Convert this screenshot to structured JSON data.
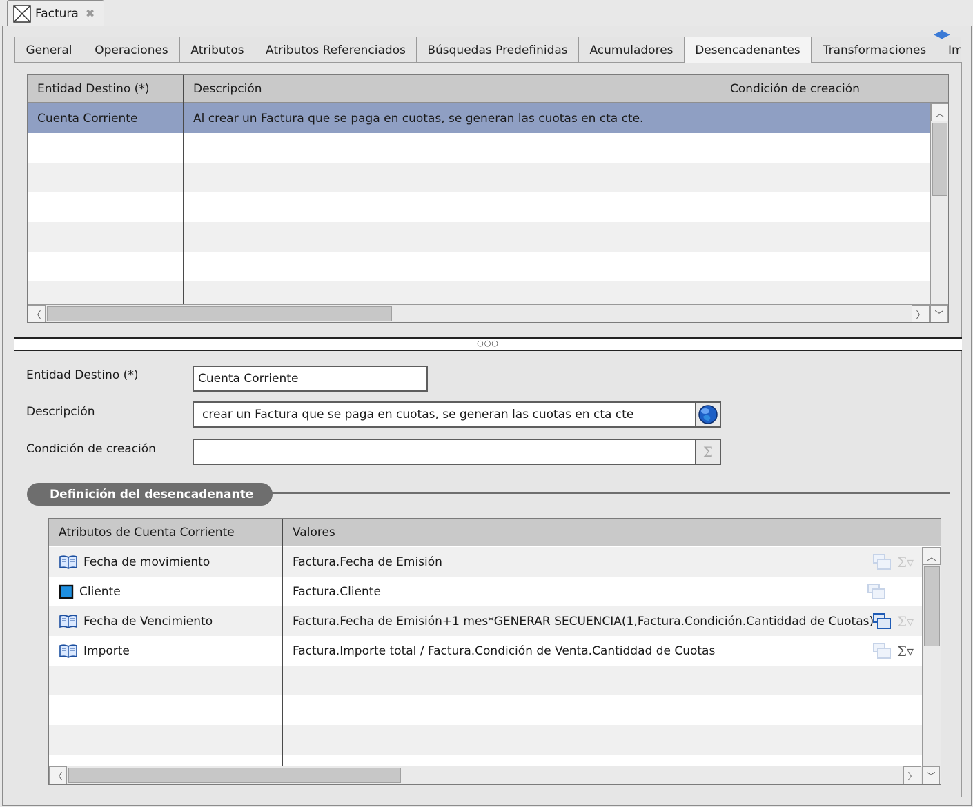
{
  "editor": {
    "title": "Factura"
  },
  "tabs": [
    {
      "label": "General"
    },
    {
      "label": "Operaciones"
    },
    {
      "label": "Atributos"
    },
    {
      "label": "Atributos Referenciados"
    },
    {
      "label": "Búsquedas Predefinidas"
    },
    {
      "label": "Acumuladores"
    },
    {
      "label": "Desencadenantes"
    },
    {
      "label": "Transformaciones"
    },
    {
      "label": "Im"
    }
  ],
  "active_tab": "Desencadenantes",
  "triggers_table": {
    "columns": [
      "Entidad Destino (*)",
      "Descripción",
      "Condición de creación"
    ],
    "rows": [
      {
        "entidad": "Cuenta Corriente",
        "descripcion": "Al crear un Factura que se paga en cuotas, se generan las cuotas en cta cte.",
        "condicion": ""
      }
    ]
  },
  "form": {
    "entidad_label": "Entidad Destino (*)",
    "entidad_value": "Cuenta Corriente",
    "descripcion_label": "Descripción",
    "descripcion_value": "crear un Factura que se paga en cuotas, se generan las cuotas en cta cte",
    "condicion_label": "Condición de creación",
    "condicion_value": ""
  },
  "section": {
    "title": "Definición del desencadenante"
  },
  "definition_table": {
    "columns": [
      "Atributos de Cuenta Corriente",
      "Valores"
    ],
    "rows": [
      {
        "icon": "book-icon",
        "attr": "Fecha de movimiento",
        "valor": "Factura.Fecha de Emisión",
        "sigma": true,
        "sigma_active": false,
        "copy_active": false
      },
      {
        "icon": "entity-square-icon",
        "attr": "Cliente",
        "valor": "Factura.Cliente",
        "sigma": false,
        "sigma_active": false,
        "copy_active": false
      },
      {
        "icon": "book-icon",
        "attr": "Fecha de Vencimiento",
        "valor": "Factura.Fecha de Emisión+1 mes*GENERAR SECUENCIA(1,Factura.Condición.Cantiddad de Cuotas)",
        "sigma": true,
        "sigma_active": false,
        "copy_active": true
      },
      {
        "icon": "book-icon",
        "attr": "Importe",
        "valor": "Factura.Importe total / Factura.Condición de Venta.Cantiddad de Cuotas",
        "sigma": true,
        "sigma_active": true,
        "copy_active": false
      }
    ]
  },
  "colors": {
    "selection": "#8f9fc3",
    "header": "#c9c9c9",
    "pill": "#6e6e6e",
    "accent": "#3b7ad6"
  }
}
